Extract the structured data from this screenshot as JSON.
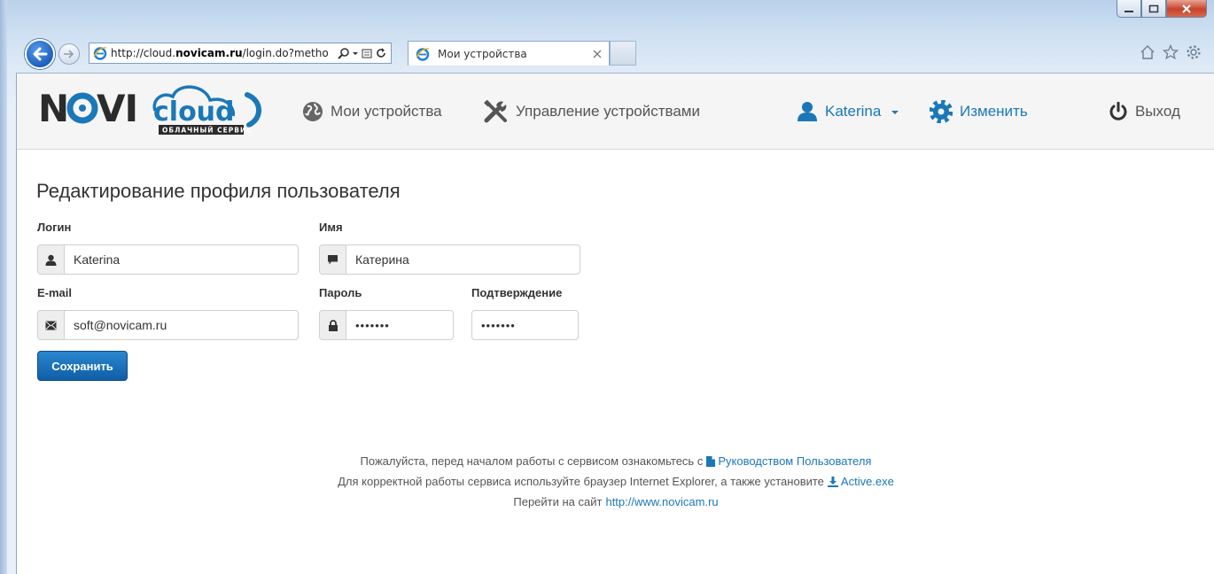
{
  "browser": {
    "address_plain": "http://cloud.",
    "address_bold": "novicam.ru",
    "address_rest": "/login.do?metho",
    "tab_title": "Мои устройства"
  },
  "header": {
    "nav": {
      "my_devices": "Мои устройства",
      "device_management": "Управление устройствами",
      "user": "Katerina",
      "settings": "Изменить",
      "logout": "Выход"
    }
  },
  "form": {
    "title": "Редактирование профиля пользователя",
    "login_label": "Логин",
    "login_value": "Katerina",
    "name_label": "Имя",
    "name_value": "Катерина",
    "email_label": "E-mail",
    "email_value": "soft@novicam.ru",
    "password_label": "Пароль",
    "password_value": "•••••••",
    "confirm_label": "Подтверждение",
    "confirm_value": "•••••••",
    "save_label": "Сохранить"
  },
  "footer": {
    "line1_text": "Пожалуйста, перед началом работы с сервисом ознакомьтесь с",
    "line1_link": "Руководством Пользователя",
    "line2_text": "Для корректной работы сервиса используйте браузер Internet Explorer, а также установите",
    "line2_link": "Active.exe",
    "line3_text": "Перейти на сайт",
    "line3_link": "http://www.novicam.ru"
  },
  "colors": {
    "accent": "#1a78b8",
    "button": "#1565a8"
  }
}
